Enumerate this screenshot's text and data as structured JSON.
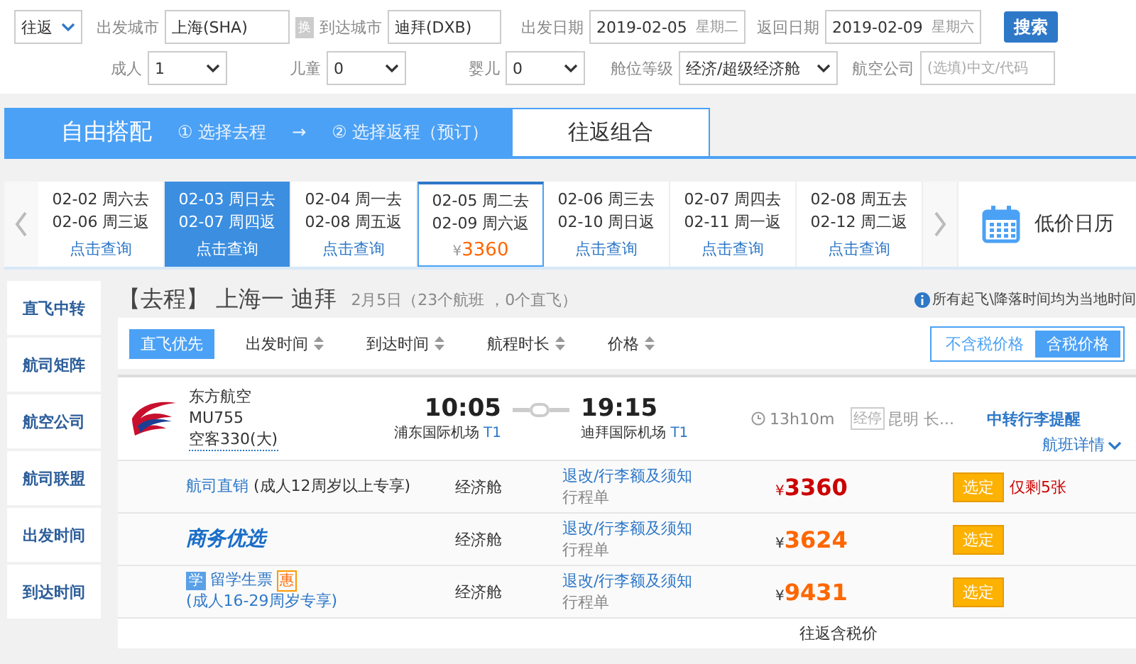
{
  "search_form": {
    "trip_type": "往返",
    "from_label": "出发城市",
    "from_value": "上海(SHA)",
    "swap": "换",
    "to_label": "到达城市",
    "to_value": "迪拜(DXB)",
    "depart_label": "出发日期",
    "depart_date": "2019-02-05",
    "depart_weekday": "星期二",
    "return_label": "返回日期",
    "return_date": "2019-02-09",
    "return_weekday": "星期六",
    "search_button": "搜索",
    "passengers": [
      {
        "label": "成人",
        "value": "1"
      },
      {
        "label": "儿童",
        "value": "0"
      },
      {
        "label": "婴儿",
        "value": "0"
      }
    ],
    "cabin_label": "舱位等级",
    "cabin_value": "经济/超级经济舱",
    "airline_label": "航空公司",
    "airline_placeholder": "(选填)中文/代码"
  },
  "mode_tabs": [
    {
      "label": "自由搭配",
      "selected": false,
      "steps": [
        "① 选择去程",
        "→",
        "② 选择返程（预订）"
      ]
    },
    {
      "label": "往返组合",
      "selected": true
    }
  ],
  "date_strip": [
    {
      "depart": "02-02 周六去",
      "return": "02-06 周三返",
      "link": "点击查询",
      "highlighted": false,
      "selected": false
    },
    {
      "depart": "02-03 周日去",
      "return": "02-07 周四返",
      "link": "点击查询",
      "highlighted": true,
      "selected": false
    },
    {
      "depart": "02-04 周一去",
      "return": "02-08 周五返",
      "link": "点击查询",
      "highlighted": false,
      "selected": false
    },
    {
      "depart": "02-05 周二去",
      "return": "02-09 周六返",
      "currency": "¥",
      "price": "3360",
      "highlighted": false,
      "selected": true
    },
    {
      "depart": "02-06 周三去",
      "return": "02-10 周日返",
      "link": "点击查询",
      "highlighted": false,
      "selected": false
    },
    {
      "depart": "02-07 周四去",
      "return": "02-11 周一返",
      "link": "点击查询",
      "highlighted": false,
      "selected": false
    },
    {
      "depart": "02-08 周五去",
      "return": "02-12 周二返",
      "link": "点击查询",
      "highlighted": false,
      "selected": false
    }
  ],
  "calendar_link": "低价日历",
  "sidebar": {
    "items": [
      "直飞中转",
      "航司矩阵",
      "航空公司",
      "航司联盟",
      "出发时间",
      "到达时间"
    ]
  },
  "heading": {
    "leg": "【去程】",
    "route": "上海一 迪拜",
    "summary": "2月5日（23个航班 ，0个直飞）",
    "note": "所有起飞\\降落时间均为当地时间"
  },
  "sort_bar": {
    "options": [
      {
        "label": "直飞优先",
        "selected": true,
        "sortable": false
      },
      {
        "label": "出发时间",
        "selected": false,
        "sortable": true
      },
      {
        "label": "到达时间",
        "selected": false,
        "sortable": true
      },
      {
        "label": "航程时长",
        "selected": false,
        "sortable": true
      },
      {
        "label": "价格",
        "selected": false,
        "sortable": true
      }
    ],
    "tax_toggle": [
      {
        "label": "不含税价格",
        "selected": false
      },
      {
        "label": "含税价格",
        "selected": true
      }
    ]
  },
  "flight": {
    "airline": "东方航空",
    "flight_no": "MU755",
    "aircraft": "空客330(大)",
    "depart_time": "10:05",
    "depart_airport": "浦东国际机场",
    "depart_terminal": "T1",
    "arrive_time": "19:15",
    "arrive_airport": "迪拜国际机场",
    "arrive_terminal": "T1",
    "duration": "13h10m",
    "stop_label": "经停",
    "stop_city": "昆明 长...",
    "baggage_note": "中转行李提醒",
    "details_link": "航班详情"
  },
  "fares": [
    {
      "kind": "direct",
      "name": "航司直销",
      "note": "(成人12周岁以上专享)",
      "cabin": "经济舱",
      "rules": "退改/行李额及须知",
      "itinerary": "行程单",
      "currency": "¥",
      "price": "3360",
      "highlight": true,
      "book": "选定",
      "remark": "仅剩5张"
    },
    {
      "kind": "business",
      "name": "商务优选",
      "cabin": "经济舱",
      "rules": "退改/行李额及须知",
      "itinerary": "行程单",
      "currency": "¥",
      "price": "3624",
      "highlight": false,
      "book": "选定"
    },
    {
      "kind": "student",
      "badge": "学",
      "name": "留学生票",
      "tag": "惠",
      "note": "(成人16-29周岁专享)",
      "cabin": "经济舱",
      "rules": "退改/行李额及须知",
      "itinerary": "行程单",
      "currency": "¥",
      "price": "9431",
      "highlight": false,
      "book": "选定"
    }
  ],
  "footer_note": "往返含税价"
}
